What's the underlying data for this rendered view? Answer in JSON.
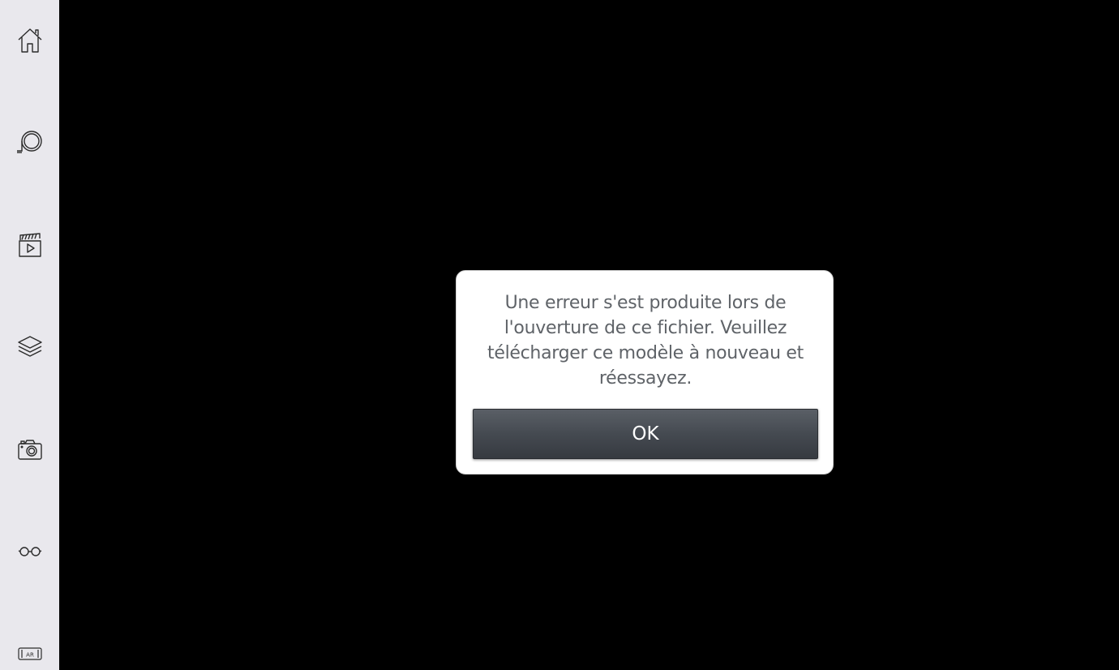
{
  "sidebar": {
    "items": [
      {
        "name": "home",
        "icon": "home-icon"
      },
      {
        "name": "measure",
        "icon": "tape-measure-icon"
      },
      {
        "name": "animations",
        "icon": "clapperboard-play-icon"
      },
      {
        "name": "layers",
        "icon": "layers-icon"
      },
      {
        "name": "snapshot",
        "icon": "camera-icon"
      },
      {
        "name": "view",
        "icon": "glasses-icon"
      },
      {
        "name": "ar",
        "icon": "ar-icon",
        "label": "AR"
      }
    ]
  },
  "dialog": {
    "message": "Une erreur s'est produite lors de l'ouverture de ce fichier. Veuillez télécharger ce modèle à nouveau et réessayez.",
    "ok_label": "OK"
  },
  "colors": {
    "sidebar_bg": "#e9e8ed",
    "viewport_bg": "#000000",
    "dialog_bg": "#ffffff",
    "message_text": "#5f6368",
    "button_bg": "#454a51",
    "button_text": "#ffffff",
    "icon_stroke": "#2b2b2b"
  }
}
